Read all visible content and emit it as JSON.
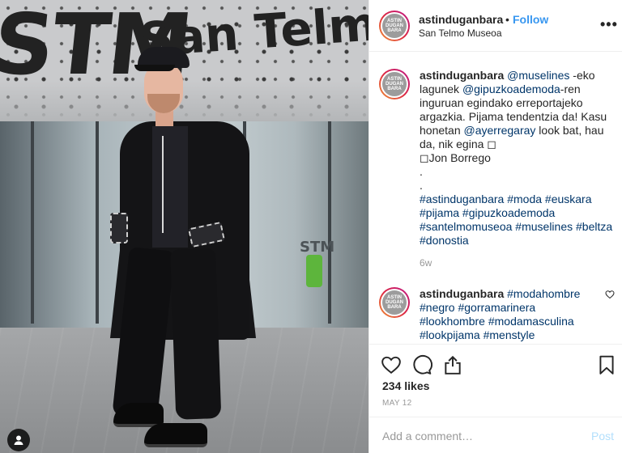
{
  "photo": {
    "sign_logo": "STM",
    "sign_name": "San Telmo",
    "glass_sign": "STM"
  },
  "header": {
    "username": "astinduganbara",
    "separator": "•",
    "follow_label": "Follow",
    "location": "San Telmo Museoa",
    "more_label": "•••"
  },
  "avatar_label": "ASTIN\nDUGAN\nBARA",
  "caption": {
    "username": "astinduganbara",
    "mention_1": "@muselines",
    "text_1": " -eko lagunek ",
    "mention_2": "@gipuzkoademoda",
    "text_2": "-ren inguruan egindako erreportajeko argazkia. Pijama tendentzia da! Kasu honetan ",
    "mention_3": "@ayerregaray",
    "text_3": " look bat, hau da, nik egina ◻",
    "line_credit": "◻Jon Borrego",
    "dot_1": ".",
    "dot_2": ".",
    "hashtags": [
      "#astinduganbara",
      "#moda",
      "#euskara",
      "#pijama",
      "#gipuzkoademoda",
      "#santelmomuseoa",
      "#muselines",
      "#beltza",
      "#donostia"
    ],
    "time": "6w"
  },
  "comment_2": {
    "username": "astinduganbara",
    "hashtags": [
      "#modahombre",
      "#negro",
      "#gorramarinera",
      "#lookhombre",
      "#modamasculina",
      "#lookpijama",
      "#menstyle"
    ]
  },
  "actions": {
    "likes": "234 likes",
    "date": "MAY 12"
  },
  "comment_input": {
    "placeholder": "Add a comment…",
    "post_label": "Post"
  },
  "icons": {
    "like": "heart-icon",
    "comment": "comment-bubble-icon",
    "share": "share-icon",
    "save": "bookmark-icon",
    "tag": "user-tag-icon",
    "more": "more-options-icon"
  },
  "colors": {
    "link_blue": "#3897f0",
    "mention_navy": "#003569",
    "muted_gray": "#999999",
    "post_disabled": "#b2dffc"
  }
}
